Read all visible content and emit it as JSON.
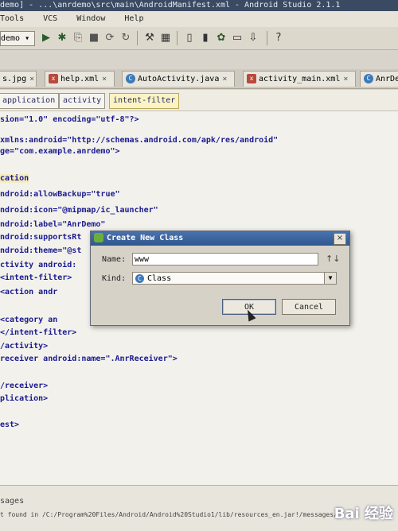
{
  "window": {
    "title": "demo] - ...\\anrdemo\\src\\main\\AndroidManifest.xml - Android Studio 2.1.1"
  },
  "menu": [
    "Tools",
    "VCS",
    "Window",
    "Help"
  ],
  "toolbar": {
    "config_label": "demo",
    "help_icon": "?"
  },
  "tabs": [
    {
      "label": "s.jpg",
      "type": "image"
    },
    {
      "label": "help.xml",
      "type": "xml"
    },
    {
      "label": "AutoActivity.java",
      "type": "java"
    },
    {
      "label": "activity_main.xml",
      "type": "xml"
    },
    {
      "label": "AnrDe",
      "type": "java"
    }
  ],
  "breadcrumb": [
    "application",
    "activity",
    "intent-filter"
  ],
  "code": [
    "sion=\"1.0\" encoding=\"utf-8\"?>",
    " xmlns:android=\"http://schemas.android.com/apk/res/android\"",
    "ge=\"com.example.anrdemo\">",
    "",
    "cation",
    "ndroid:allowBackup=\"true\"",
    "ndroid:icon=\"@mipmap/ic_launcher\"",
    "ndroid:label=\"AnrDemo\"",
    "ndroid:supportsRt",
    "ndroid:theme=\"@st",
    "ctivity android:",
    "  <intent-filter>",
    "    <action andr",
    "",
    "    <category an",
    "  </intent-filter>",
    "/activity>",
    "receiver android:name=\".AnrReceiver\">",
    "",
    "/receiver>",
    "plication>",
    "",
    "est>"
  ],
  "dialog": {
    "title": "Create New Class",
    "name_label": "Name:",
    "name_value": "www",
    "kind_label": "Kind:",
    "kind_value": "Class",
    "kind_icon": "C",
    "sort_icon": "↑↓",
    "ok_label": "OK",
    "cancel_label": "Cancel",
    "close_icon": "×"
  },
  "bottom": {
    "line1": "sages",
    "line2": "t found in /C:/Program%20Files/Android/Android%20Studio1/lib/resources_en.jar!/messages/"
  },
  "watermark": "Bai 经验"
}
